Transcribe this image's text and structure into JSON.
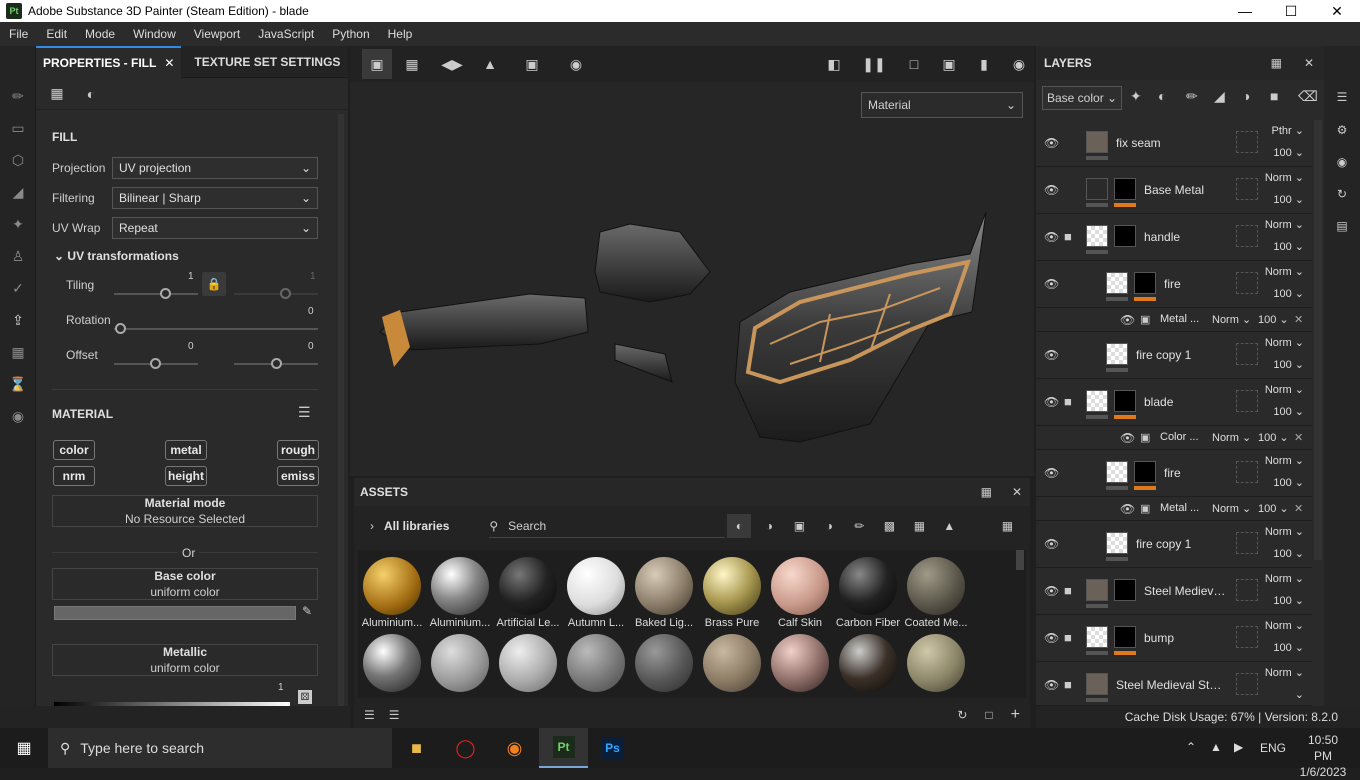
{
  "window": {
    "title": "Adobe Substance 3D Painter (Steam Edition) - blade",
    "app_icon": "Pt"
  },
  "menu": [
    "File",
    "Edit",
    "Mode",
    "Window",
    "Viewport",
    "JavaScript",
    "Python",
    "Help"
  ],
  "properties": {
    "tab_fill": "PROPERTIES - FILL",
    "tab_texture": "TEXTURE SET SETTINGS",
    "fill_title": "FILL",
    "projection_label": "Projection",
    "projection_value": "UV projection",
    "filtering_label": "Filtering",
    "filtering_value": "Bilinear | Sharp",
    "uvwrap_label": "UV Wrap",
    "uvwrap_value": "Repeat",
    "uvtrans_title": "UV transformations",
    "tiling_label": "Tiling",
    "tiling_value": "1",
    "tiling_value2": "1",
    "rotation_label": "Rotation",
    "rotation_value": "0",
    "offset_label": "Offset",
    "offset_value": "0",
    "offset_value2": "0",
    "material_title": "MATERIAL",
    "chips": [
      "color",
      "metal",
      "rough",
      "nrm",
      "height",
      "emiss"
    ],
    "material_mode": "Material mode",
    "material_mode_sub": "No Resource Selected",
    "or": "Or",
    "base_color": "Base color",
    "base_color_sub": "uniform color",
    "metallic": "Metallic",
    "metallic_sub": "uniform color",
    "metallic_value": "1"
  },
  "viewport": {
    "material_dropdown": "Material"
  },
  "assets": {
    "title": "ASSETS",
    "libraries": "All libraries",
    "search_placeholder": "Search",
    "row1": [
      "Aluminium...",
      "Aluminium...",
      "Artificial Le...",
      "Autumn L...",
      "Baked Lig...",
      "Brass Pure",
      "Calf Skin",
      "Carbon Fiber",
      "Coated Me..."
    ]
  },
  "layers": {
    "title": "LAYERS",
    "channel": "Base color",
    "items": [
      {
        "name": "fix seam",
        "blend": "Pthr",
        "op": "100"
      },
      {
        "name": "Base Metal",
        "blend": "Norm",
        "op": "100"
      },
      {
        "name": "handle",
        "blend": "Norm",
        "op": "100"
      },
      {
        "name": "fire",
        "blend": "Norm",
        "op": "100"
      },
      {
        "name": "Metal ...",
        "blend": "Norm",
        "op": "100"
      },
      {
        "name": "fire copy 1",
        "blend": "Norm",
        "op": "100"
      },
      {
        "name": "blade",
        "blend": "Norm",
        "op": "100"
      },
      {
        "name": "Color ...",
        "blend": "Norm",
        "op": "100"
      },
      {
        "name": "fire",
        "blend": "Norm",
        "op": "100"
      },
      {
        "name": "Metal ...",
        "blend": "Norm",
        "op": "100"
      },
      {
        "name": "fire copy 1",
        "blend": "Norm",
        "op": "100"
      },
      {
        "name": "Steel Medieval ...",
        "blend": "Norm",
        "op": "100"
      },
      {
        "name": "bump",
        "blend": "Norm",
        "op": "100"
      },
      {
        "name": "Steel Medieval Stylized",
        "blend": "Norm",
        "op": ""
      }
    ]
  },
  "status": {
    "text": "Cache Disk Usage:   67% | Version: 8.2.0"
  },
  "taskbar": {
    "search_placeholder": "Type here to search",
    "lang": "ENG",
    "time": "10:50 PM",
    "date": "1/6/2023"
  }
}
